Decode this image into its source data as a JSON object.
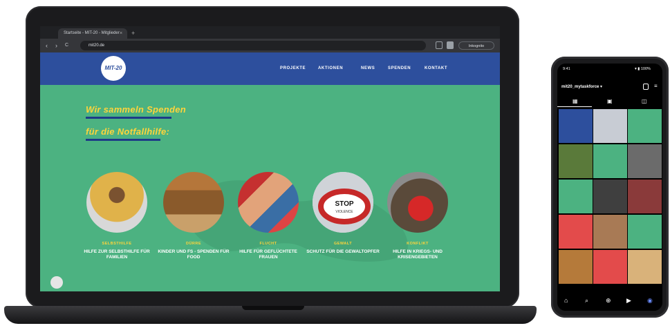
{
  "browser": {
    "tab_title": "Startseite - MIT-20 - Mitglieder",
    "tab_close": "×",
    "new_tab": "+",
    "back": "‹",
    "forward": "›",
    "reload": "C",
    "url": "mit20.de",
    "incognito_label": "Inkognito"
  },
  "site": {
    "logo_text": "MIT-20",
    "menu": [
      "PROJEKTE",
      "AKTIONEN",
      "NEWS",
      "SPENDEN",
      "KONTAKT"
    ],
    "headline_line1": "Wir sammeln Spenden",
    "headline_line2": "für die Notfallhilfe:",
    "projects": [
      {
        "category": "SELBSTHILFE",
        "title": "HILFE ZUR SELBSTHILFE FÜR FAMILIEN"
      },
      {
        "category": "DÜRRE",
        "title": "KINDER UND FS - SPENDEN FÜR FOOD"
      },
      {
        "category": "FLUCHT",
        "title": "HILFE FÜR GEFLÜCHTETE FRAUEN"
      },
      {
        "category": "GEWALT",
        "title": "SCHUTZ FÜR DIE GEWALTOPFER"
      },
      {
        "category": "KONFLIKT",
        "title": "HILFE IN KRIEGS- UND KRISENGEBIETEN"
      }
    ]
  },
  "phone": {
    "time": "9:41",
    "status_icons": "▾ ▮ 100%",
    "username": "mit20_mytaskforce ▾",
    "grid_tab_icon": "▦",
    "reels_tab_icon": "▣",
    "tagged_tab_icon": "◫",
    "nav_icons": [
      "⌂",
      "⌕",
      "⊕",
      "▶",
      "◉"
    ]
  },
  "colors": {
    "site_header": "#2d4f9d",
    "site_background": "#4cb281",
    "accent_yellow": "#ffd43b"
  }
}
